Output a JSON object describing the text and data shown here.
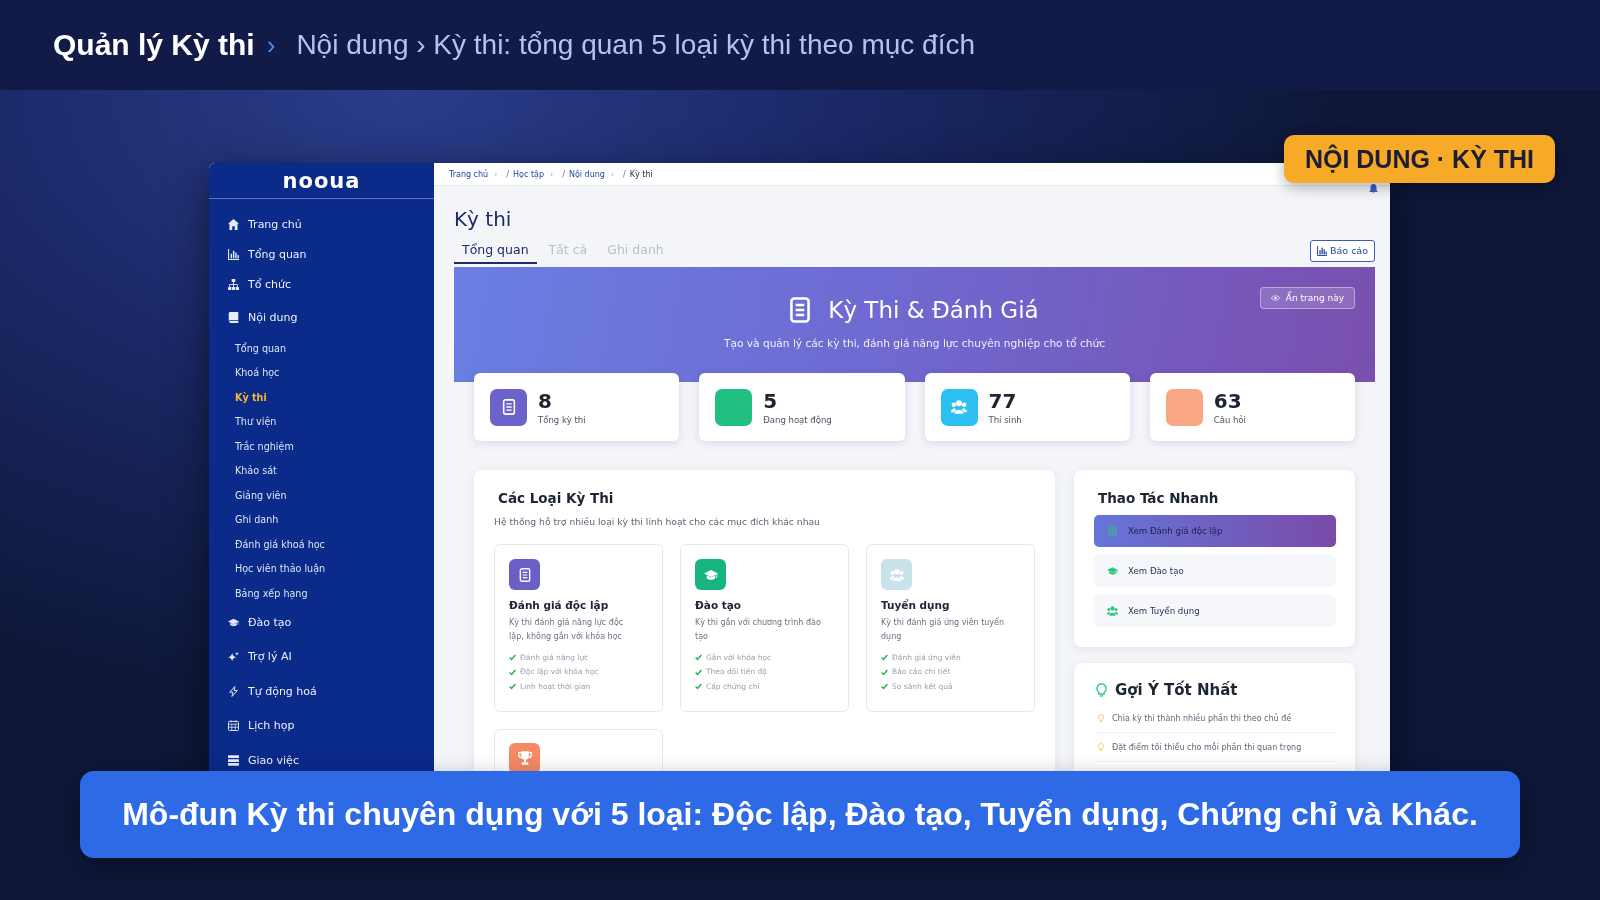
{
  "header": {
    "title": "Quản lý Kỳ thi",
    "separator": "›",
    "subtitle": "Nội dung › Kỳ thi: tổng quan 5 loại kỳ thi theo mục đích"
  },
  "badge": {
    "label": "NỘI DUNG · KỲ THI"
  },
  "app": {
    "logo": "nooua",
    "sidebar": {
      "items": [
        {
          "label": "Trang chủ",
          "selected": false
        },
        {
          "label": "Tổng quan",
          "selected": false
        },
        {
          "label": "Tổ chức",
          "selected": false
        },
        {
          "label": "Nội dung",
          "selected": false,
          "children": [
            {
              "label": "Tổng quan",
              "selected": false
            },
            {
              "label": "Khoá học",
              "selected": false
            },
            {
              "label": "Kỳ thi",
              "selected": true
            },
            {
              "label": "Thư viện",
              "selected": false
            },
            {
              "label": "Trắc nghiệm",
              "selected": false
            },
            {
              "label": "Khảo sát",
              "selected": false
            },
            {
              "label": "Giảng viên",
              "selected": false
            },
            {
              "label": "Ghi danh",
              "selected": false
            },
            {
              "label": "Đánh giá khoá học",
              "selected": false
            },
            {
              "label": "Học viên thảo luận",
              "selected": false
            },
            {
              "label": "Bảng xếp hạng",
              "selected": false
            }
          ]
        },
        {
          "label": "Đào tạo",
          "selected": false
        },
        {
          "label": "Trợ lý AI",
          "selected": false
        },
        {
          "label": "Tự động hoá",
          "selected": false
        },
        {
          "label": "Lịch họp",
          "selected": false
        },
        {
          "label": "Giao việc",
          "selected": false
        }
      ]
    },
    "breadcrumb": [
      {
        "label": "Trang chủ",
        "after": "›"
      },
      {
        "before": "/",
        "label": "Học tập",
        "after": "›"
      },
      {
        "before": "/",
        "label": "Nội dung",
        "after": "›"
      },
      {
        "before": "/",
        "label": "Kỳ thi"
      }
    ],
    "page_title": "Kỳ thi",
    "tabs": [
      {
        "label": "Tổng quan",
        "selected": true
      },
      {
        "label": "Tất cả",
        "selected": false
      },
      {
        "label": "Ghi danh",
        "selected": false
      }
    ],
    "report_button": "Báo cáo",
    "banner": {
      "title": "Kỳ Thi & Đánh Giá",
      "subtitle": "Tạo và quản lý các kỳ thi, đánh giá năng lực chuyên nghiệp cho tổ chức",
      "hide_button": "Ẩn trang này"
    },
    "stats": [
      {
        "value": "8",
        "label": "Tổng kỳ thi",
        "color": "#6b63c9"
      },
      {
        "value": "5",
        "label": "Đang hoạt động",
        "color": "#22bf82"
      },
      {
        "value": "77",
        "label": "Thí sinh",
        "color": "#2cc0f2"
      },
      {
        "value": "63",
        "label": "Câu hỏi",
        "color": "#f9a684"
      }
    ],
    "exam_types": {
      "title": "Các Loại Kỳ Thi",
      "subtitle": "Hệ thống hỗ trợ nhiều loại kỳ thi linh hoạt cho các mục đích khác nhau",
      "items": [
        {
          "title": "Đánh giá độc lập",
          "description": "Kỳ thi đánh giá năng lực độc lập, không gắn với khóa học",
          "features": [
            "Đánh giá năng lực",
            "Độc lập với khóa học",
            "Linh hoạt thời gian"
          ],
          "color": "#6b5fc7"
        },
        {
          "title": "Đào tạo",
          "description": "Kỳ thi gắn với chương trình đào tạo",
          "features": [
            "Gắn với khóa học",
            "Theo dõi tiến độ",
            "Cấp chứng chỉ"
          ],
          "color": "#17b47f"
        },
        {
          "title": "Tuyển dụng",
          "description": "Kỳ thi đánh giá ứng viên tuyển dụng",
          "features": [
            "Đánh giá ứng viên",
            "Báo cáo chi tiết",
            "So sánh kết quả"
          ],
          "color": "#c9e3ea"
        },
        {
          "color": "#f58a66"
        }
      ]
    },
    "quick_actions": {
      "title": "Thao Tác Nhanh",
      "items": [
        {
          "label": "Xem Đánh giá độc lập",
          "selected": true
        },
        {
          "label": "Xem Đào tạo",
          "selected": false
        },
        {
          "label": "Xem Tuyển dụng",
          "selected": false
        }
      ]
    },
    "tips": {
      "title": "Gợi Ý Tốt Nhất",
      "items": [
        "Chia kỳ thi thành nhiều phần thi theo chủ đề",
        "Đặt điểm tối thiểu cho mỗi phần thi quan trọng"
      ]
    }
  },
  "caption": {
    "text": "Mô-đun Kỳ thi chuyên dụng với 5 loại: Độc lập, Đào tạo, Tuyển dụng, Chứng chỉ và Khác."
  }
}
